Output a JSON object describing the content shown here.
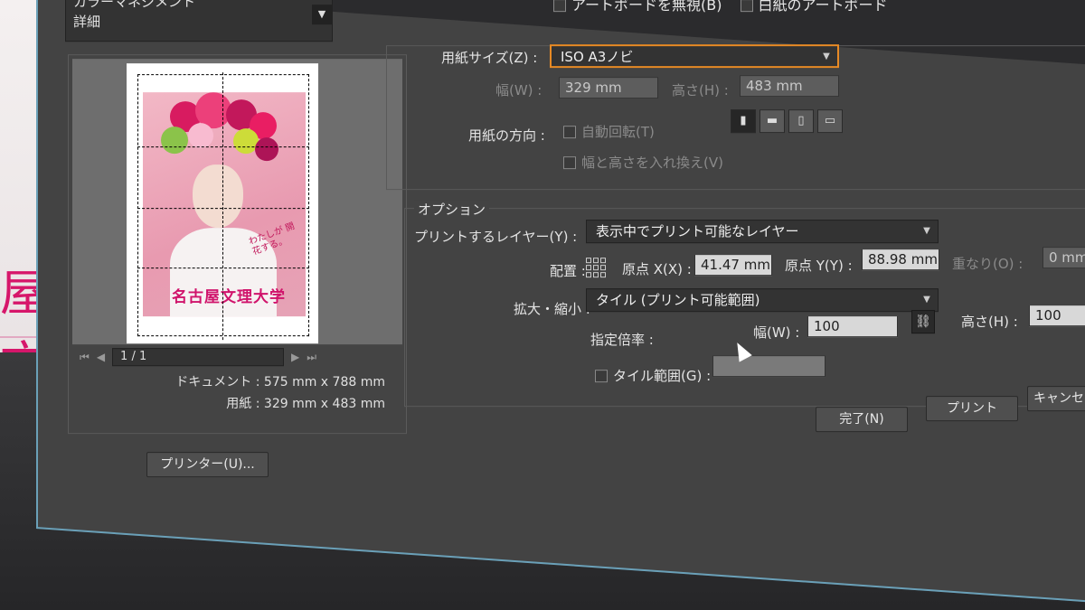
{
  "left_panel": {
    "selector_items": [
      "カラーマネジメント",
      "詳細"
    ],
    "page_indicator": "1 / 1",
    "document_label": "ドキュメント : 575 mm x 788 mm",
    "paper_label": "用紙 : 329 mm x 483 mm",
    "printer_button": "プリンター(U)...",
    "poster": {
      "title": "名古屋文理大学",
      "subtitle": "わたしが 開花する。"
    }
  },
  "background": {
    "pink_text": "屋文"
  },
  "top_checks": {
    "ignore_artboard": "アートボードを無視(B)",
    "second": "白紙のアートボード"
  },
  "paper": {
    "size_label": "用紙サイズ(Z) :",
    "size_value": "ISO A3ノビ",
    "width_label": "幅(W) :",
    "width_value": "329 mm",
    "height_label": "高さ(H) :",
    "height_value": "483 mm",
    "orientation_label": "用紙の方向 :",
    "auto_rotate": "自動回転(T)",
    "swap_label": "幅と高さを入れ換え(V)"
  },
  "options": {
    "title": "オプション",
    "layers_label": "プリントするレイヤー(Y) :",
    "layers_value": "表示中でプリント可能なレイヤー",
    "placement_label": "配置 :",
    "origin_x_label": "原点 X(X) :",
    "origin_x_value": "41.47 mm",
    "origin_y_label": "原点 Y(Y) :",
    "origin_y_value": "88.98 mm",
    "overlap_label": "重なり(O) :",
    "overlap_value": "0 mm",
    "scale_label": "拡大・縮小 :",
    "scale_value": "タイル (プリント可能範囲)",
    "custom_scale_label": "指定倍率 :",
    "scale_width_label": "幅(W) :",
    "scale_width_value": "100",
    "scale_height_label": "高さ(H) :",
    "scale_height_value": "100",
    "tile_range_label": "タイル範囲(G) :"
  },
  "buttons": {
    "done": "完了(N)",
    "print": "プリント",
    "cancel": "キャンセル"
  },
  "colors": {
    "accent_focus": "#e88a25",
    "dialog_bg": "#434343",
    "poster_pink": "#d0136b"
  }
}
